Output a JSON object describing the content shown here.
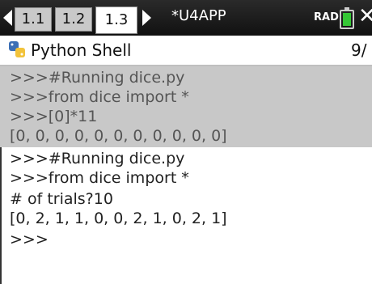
{
  "tabs": [
    "1.1",
    "1.2",
    "1.3"
  ],
  "active_tab": "1.3",
  "document_title": "*U4APP",
  "angle_mode": "RAD",
  "colors": {
    "battery": "#35c735",
    "topbar": "#1b1b1b",
    "history_bg": "#c8c8c8"
  },
  "app": {
    "title": "Python Shell",
    "page": "9/"
  },
  "history": [
    ">>>#Running dice.py",
    ">>>from dice import *",
    ">>>[0]*11",
    "[0, 0, 0, 0, 0, 0, 0, 0, 0, 0, 0]"
  ],
  "current": [
    ">>>#Running dice.py",
    ">>>from dice import *",
    "# of trials?10",
    "[0, 2, 1, 1, 0, 0, 2, 1, 0, 2, 1]",
    ">>>"
  ],
  "icons": [
    "nav-left-icon",
    "nav-right-icon",
    "battery-icon",
    "close-icon",
    "python-icon"
  ]
}
